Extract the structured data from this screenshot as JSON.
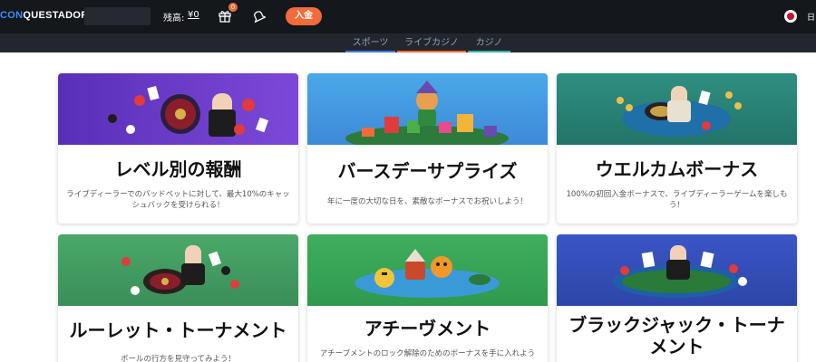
{
  "header": {
    "logo": "QUESTADOR",
    "logo_prefix": "CON",
    "balance_label": "残高:",
    "balance_value": "¥0",
    "gift_badge": "0",
    "deposit_label": "入金",
    "language": "日"
  },
  "nav": {
    "tabs": [
      {
        "label": "スポーツ",
        "color": "#3b7ddd"
      },
      {
        "label": "ライブカジノ",
        "color": "#f26b3a"
      },
      {
        "label": "カジノ",
        "color": "#2fb5a5"
      }
    ]
  },
  "colors": {
    "topbar": "#14171b",
    "accent_orange": "#f26b3a",
    "logo_blue": "#3d8cff"
  },
  "cards": [
    {
      "title": "レベル別の報酬",
      "description": "ライブディーラーでのバッドベットに対して、最大10%のキャッシュバックを受けられる！",
      "banner": "purple-casino-chips-banner",
      "banner_color": "#6b3fc6"
    },
    {
      "title": "バースデーサプライズ",
      "description": "年に一度の大切な日を、素敵なボーナスでお祝いしよう！",
      "banner": "blue-birthday-gifts-banner",
      "banner_color": "#3d9de0"
    },
    {
      "title": "ウエルカムボーナス",
      "description": "100%の初回入金ボーナスで、ライブディーラーゲームを楽しもう！",
      "banner": "teal-roulette-dealer-banner",
      "banner_color": "#2a8a7e"
    },
    {
      "title": "ルーレット・トーナメント",
      "description": "ボールの行方を見守ってみよう！",
      "banner": "green-roulette-dealer-banner",
      "banner_color": "#3d9a5a"
    },
    {
      "title": "アチーヴメント",
      "description": "アチーブメントのロック解除のためのボーナスを手に入れよう",
      "banner": "green-ocean-characters-banner",
      "banner_color": "#35a35a"
    },
    {
      "title": "ブラックジャック・トーナメント",
      "description": "",
      "banner": "blue-blackjack-table-banner",
      "banner_color": "#3d58c8"
    }
  ]
}
